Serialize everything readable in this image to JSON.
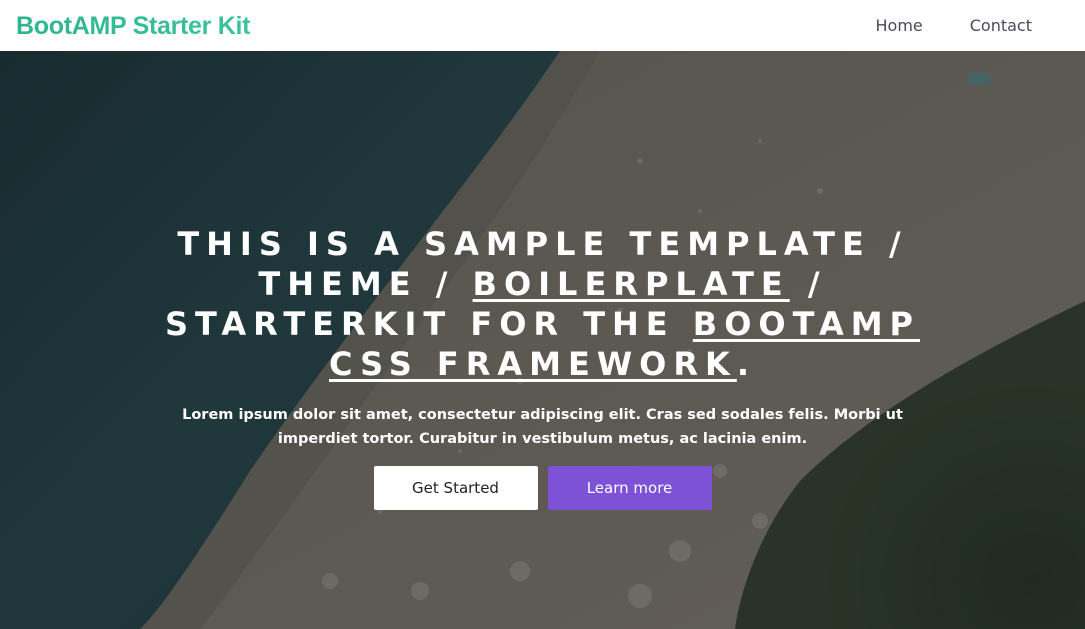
{
  "navbar": {
    "brand": "BootAMP Starter Kit",
    "links": [
      "Home",
      "Contact"
    ]
  },
  "hero": {
    "title_parts": {
      "p1": "This is a sample template / theme / ",
      "link1": "boilerplate",
      "p2": " / starterkit for the ",
      "link2": "BootAMP CSS Framework",
      "p3": "."
    },
    "subtitle": "Lorem ipsum dolor sit amet, consectetur adipiscing elit. Cras sed sodales felis. Morbi ut imperdiet tortor. Curabitur in vestibulum metus, ac lacinia enim.",
    "buttons": {
      "primary": "Get Started",
      "secondary": "Learn more"
    }
  },
  "colors": {
    "brand": "#2eb58a",
    "accent": "#7d52d6",
    "nav_text": "#4a4a5a"
  }
}
